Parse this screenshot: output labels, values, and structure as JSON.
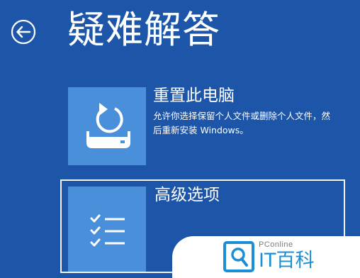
{
  "screen": {
    "title": "疑难解答",
    "background_color": "#1d56a8"
  },
  "back": {
    "icon": "arrow-left-circle-icon"
  },
  "options": [
    {
      "title": "重置此电脑",
      "description": "允许你选择保留个人文件或删除个人文件，然后重新安装 Windows。",
      "icon": "reset-pc-icon",
      "tile_color": "#4a8fd9"
    },
    {
      "title": "高级选项",
      "icon": "checklist-icon",
      "tile_color": "#4a8fd9",
      "focused": true
    }
  ],
  "watermark": {
    "brand": "PConline",
    "name": "IT百科",
    "icon": "pconline-logo-icon",
    "brand_color": "#1b8fd6"
  }
}
